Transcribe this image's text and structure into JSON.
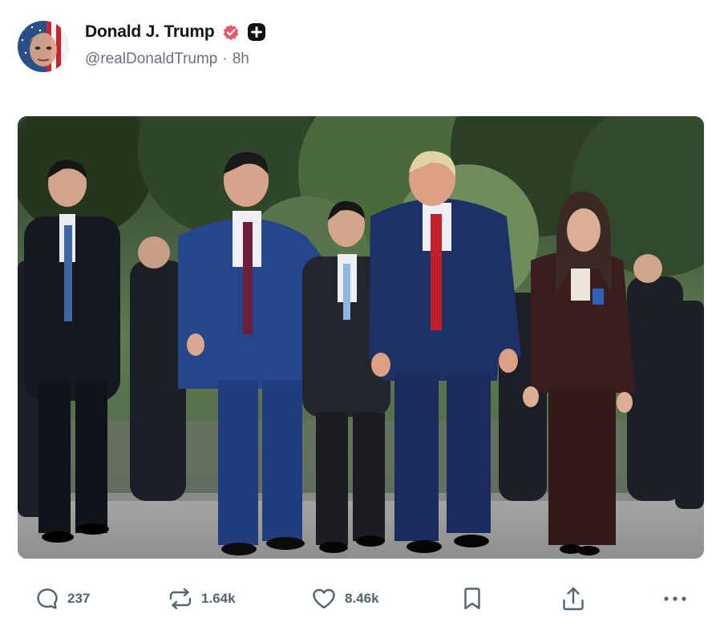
{
  "post": {
    "author": {
      "display_name": "Donald J. Trump",
      "handle": "@realDonaldTrump",
      "verified_icon": "verified-badge-icon",
      "extra_icon": "plus-badge-icon"
    },
    "separator": "·",
    "time": "8h",
    "media": {
      "description_icon": "photo"
    },
    "actions": {
      "replies": "237",
      "reposts": "1.64k",
      "likes": "8.46k"
    }
  },
  "colors": {
    "verified_badge": "#e8556b",
    "text_primary": "#0f1419",
    "text_secondary": "#6b7280",
    "icon_gray": "#536471"
  }
}
